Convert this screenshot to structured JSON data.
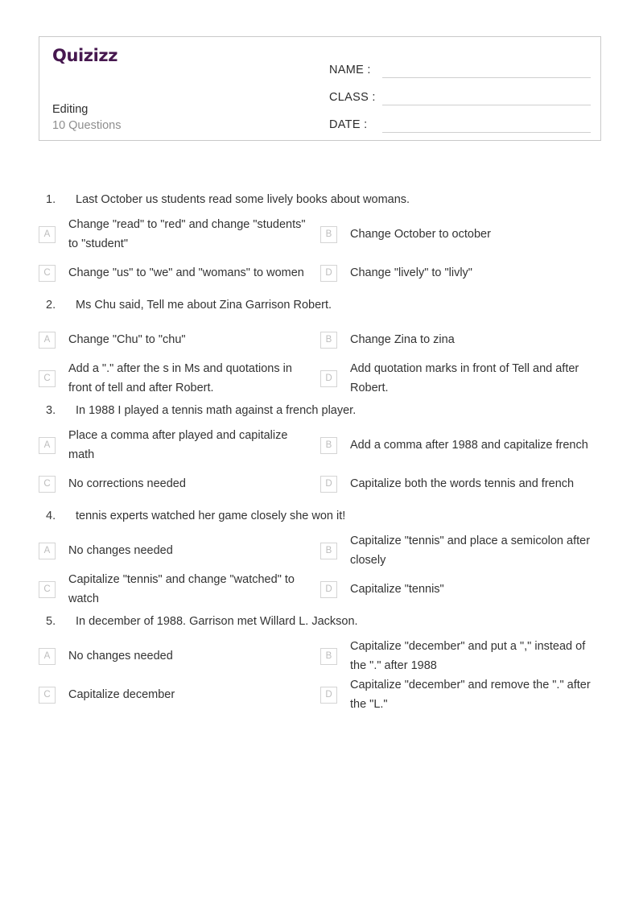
{
  "header": {
    "logo_text": "Quizizz",
    "quiz_title": "Editing",
    "question_count_label": "10 Questions",
    "fields": [
      {
        "label": "NAME :"
      },
      {
        "label": "CLASS :"
      },
      {
        "label": "DATE  :"
      }
    ]
  },
  "questions": [
    {
      "number": "1.",
      "text": "Last October us students read some lively books about womans.",
      "options": [
        {
          "letter": "A",
          "text": "Change \"read\" to \"red\" and change \"students\" to \"student\""
        },
        {
          "letter": "B",
          "text": "Change October to october"
        },
        {
          "letter": "C",
          "text": "Change \"us\" to \"we\" and \"womans\" to women"
        },
        {
          "letter": "D",
          "text": "Change \"lively\" to \"livly\""
        }
      ]
    },
    {
      "number": "2.",
      "text": "Ms Chu said, Tell me about Zina Garrison Robert.",
      "options": [
        {
          "letter": "A",
          "text": "Change \"Chu\" to \"chu\""
        },
        {
          "letter": "B",
          "text": "Change Zina to zina"
        },
        {
          "letter": "C",
          "text": "Add a \".\" after the s in Ms and quotations in front of tell and after Robert."
        },
        {
          "letter": "D",
          "text": "Add quotation marks in front of Tell and after Robert."
        }
      ]
    },
    {
      "number": "3.",
      "text": "In 1988 I played a tennis math against a french player.",
      "options": [
        {
          "letter": "A",
          "text": "Place a comma after played and capitalize math"
        },
        {
          "letter": "B",
          "text": "Add a comma after 1988 and capitalize french"
        },
        {
          "letter": "C",
          "text": "No corrections needed"
        },
        {
          "letter": "D",
          "text": "Capitalize both the words tennis and french"
        }
      ]
    },
    {
      "number": "4.",
      "text": "tennis experts watched her game closely she won it!",
      "options": [
        {
          "letter": "A",
          "text": "No changes needed"
        },
        {
          "letter": "B",
          "text": "Capitalize \"tennis\" and place a semicolon after closely"
        },
        {
          "letter": "C",
          "text": "Capitalize \"tennis\" and change \"watched\" to watch"
        },
        {
          "letter": "D",
          "text": "Capitalize \"tennis\""
        }
      ]
    },
    {
      "number": "5.",
      "text": "In december of 1988. Garrison met Willard L. Jackson.",
      "options": [
        {
          "letter": "A",
          "text": "No changes needed"
        },
        {
          "letter": "B",
          "text": "Capitalize \"december\" and put a \",\" instead of the \".\" after 1988"
        },
        {
          "letter": "C",
          "text": "Capitalize december"
        },
        {
          "letter": "D",
          "text": "Capitalize \"december\" and remove the \".\" after the \"L.\""
        }
      ]
    }
  ],
  "colors": {
    "brand": "#46184f",
    "text": "#333333",
    "muted": "#8e8e8e",
    "border": "#c9c9c9",
    "letter_box_border": "#d4d4d4"
  }
}
